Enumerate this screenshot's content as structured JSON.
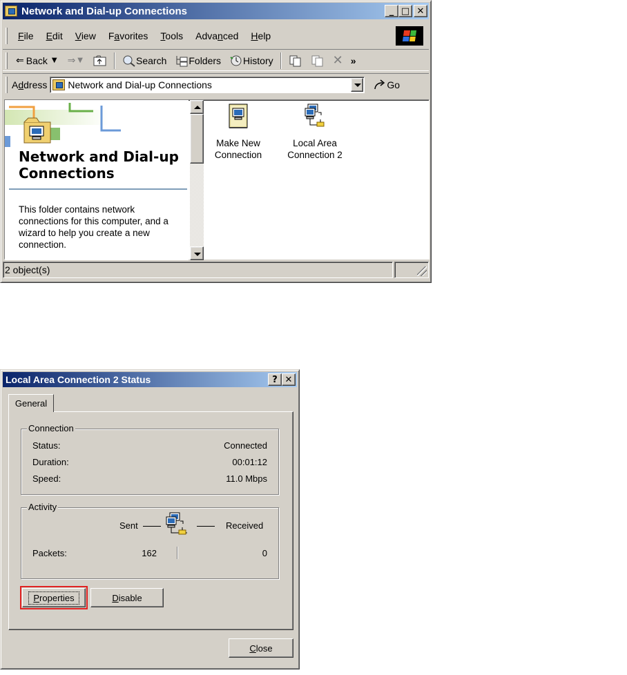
{
  "explorer": {
    "title": "Network and Dial-up Connections",
    "menu": [
      {
        "pre": "",
        "u": "F",
        "post": "ile"
      },
      {
        "pre": "",
        "u": "E",
        "post": "dit"
      },
      {
        "pre": "",
        "u": "V",
        "post": "iew"
      },
      {
        "pre": "F",
        "u": "a",
        "post": "vorites"
      },
      {
        "pre": "",
        "u": "T",
        "post": "ools"
      },
      {
        "pre": "Adva",
        "u": "n",
        "post": "ced"
      },
      {
        "pre": "",
        "u": "H",
        "post": "elp"
      }
    ],
    "toolbar": {
      "back": "Back",
      "search": "Search",
      "folders": "Folders",
      "history": "History",
      "chevron": "»"
    },
    "address": {
      "label_pre": "A",
      "label_u": "d",
      "label_post": "dress",
      "value": "Network and Dial-up Connections",
      "go": "Go"
    },
    "webview": {
      "title": "Network and Dial-up Connections",
      "description": "This folder contains network connections for this computer, and a wizard to help you create a new connection."
    },
    "items": [
      {
        "label": "Make New Connection",
        "icon": "make-new-connection-icon"
      },
      {
        "label": "Local Area Connection 2",
        "icon": "lan-connection-icon"
      }
    ],
    "status": "2 object(s)"
  },
  "dialog": {
    "title": "Local Area Connection 2 Status",
    "tab": "General",
    "connection": {
      "legend": "Connection",
      "rows": [
        {
          "label": "Status:",
          "value": "Connected"
        },
        {
          "label": "Duration:",
          "value": "00:01:12"
        },
        {
          "label": "Speed:",
          "value": "11.0 Mbps"
        }
      ]
    },
    "activity": {
      "legend": "Activity",
      "sent_label": "Sent",
      "received_label": "Received",
      "packets_label": "Packets:",
      "sent_packets": "162",
      "received_packets": "0"
    },
    "buttons": {
      "properties_u": "P",
      "properties_rest": "roperties",
      "disable_u": "D",
      "disable_rest": "isable",
      "close_u": "C",
      "close_rest": "lose"
    }
  },
  "colors": {
    "title_active_start": "#0a246a",
    "title_active_end": "#a6caf0",
    "face": "#d4d0c8",
    "highlight_box": "#e02020"
  }
}
